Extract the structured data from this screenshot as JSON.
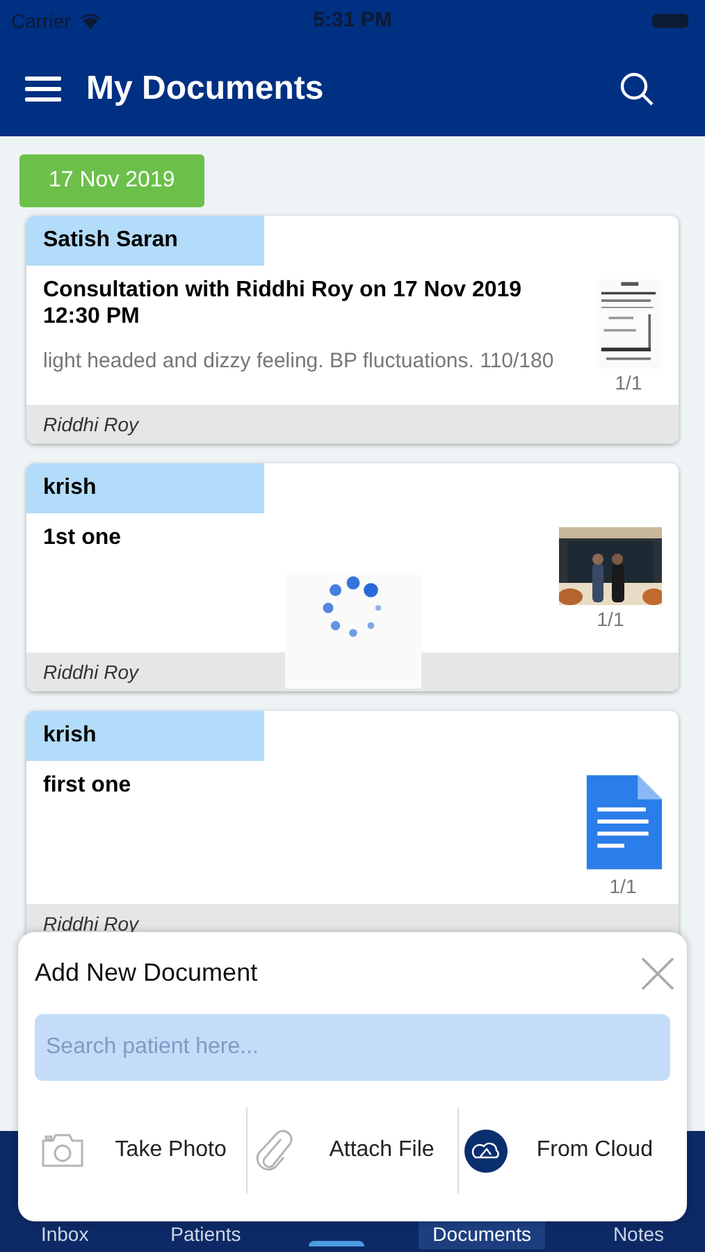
{
  "status_bar": {
    "carrier": "Carrier",
    "time": "5:31 PM"
  },
  "header": {
    "title": "My Documents"
  },
  "date_badge": "17 Nov 2019",
  "documents": [
    {
      "patient": "Satish Saran",
      "title": "Consultation with Riddhi Roy on 17 Nov 2019 12:30 PM",
      "note": "light headed and dizzy feeling. BP fluctuations. 110/180",
      "pages": "1/1",
      "doctor": "Riddhi Roy",
      "kind": "scan",
      "loading": false
    },
    {
      "patient": "krish",
      "title": "1st one",
      "pages": "1/1",
      "doctor": "Riddhi Roy",
      "loading": true
    },
    {
      "patient": "krish",
      "title": "first one",
      "pages": "1/1",
      "doctor": "Riddhi Roy",
      "kind": "doc",
      "loading": false
    }
  ],
  "sheet": {
    "title": "Add New Document",
    "search": {
      "placeholder": "Search patient here..."
    },
    "actions": [
      {
        "label": "Take Photo",
        "kind": "camera"
      },
      {
        "label": "Attach File",
        "kind": "clip"
      },
      {
        "label": "From Cloud",
        "kind": "cloud"
      }
    ]
  },
  "tab_bar": [
    {
      "label": "Inbox",
      "selected": false
    },
    {
      "label": "Patients",
      "selected": false
    },
    {
      "label": "Documents",
      "selected": true
    },
    {
      "label": "Notes",
      "selected": false
    }
  ]
}
